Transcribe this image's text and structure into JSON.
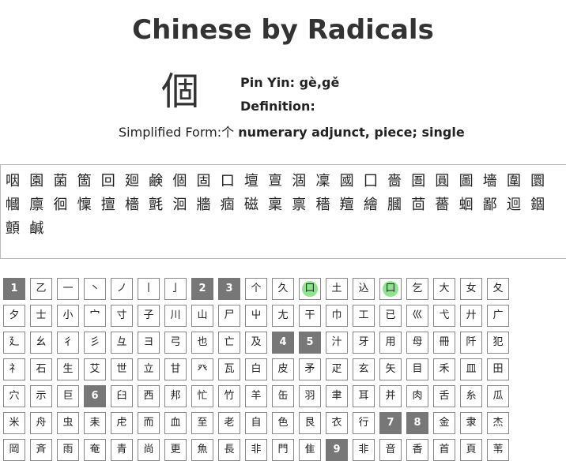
{
  "page": {
    "title": "Chinese by Radicals"
  },
  "character": {
    "glyph": "個",
    "pinyin_label": "Pin Yin: gè,gě",
    "definition_label": "Definition:",
    "simplified_label": "Simplified Form:个",
    "definition": "numerary adjunct, piece; single"
  },
  "related_chars": [
    "咽",
    "園",
    "菌",
    "箇",
    "回",
    "廻",
    "鹸",
    "個",
    "固",
    "口",
    "壇",
    "亶",
    "涸",
    "凜",
    "國",
    "囗",
    "嗇",
    "圄",
    "圓",
    "圖",
    "墻",
    "圍",
    "圜",
    "幗",
    "廪",
    "徊",
    "懍",
    "擅",
    "檣",
    "氈",
    "洄",
    "牆",
    "痼",
    "磁",
    "稟",
    "禀",
    "穡",
    "羶",
    "繪",
    "膕",
    "茴",
    "薔",
    "蛔",
    "鄙",
    "迴",
    "錮",
    "顫",
    "鹹"
  ],
  "radical_rows": [
    [
      {
        "t": "1",
        "k": "stroke"
      },
      {
        "t": "乙"
      },
      {
        "t": "一"
      },
      {
        "t": "丶"
      },
      {
        "t": "ノ"
      },
      {
        "t": "丨"
      },
      {
        "t": "亅"
      },
      {
        "t": "2",
        "k": "stroke"
      },
      {
        "t": "3",
        "k": "stroke"
      },
      {
        "t": "个"
      },
      {
        "t": "久"
      },
      {
        "t": "口",
        "k": "active"
      },
      {
        "t": "土"
      },
      {
        "t": "込"
      },
      {
        "t": "口",
        "k": "active"
      },
      {
        "t": "乞"
      },
      {
        "t": "大"
      },
      {
        "t": "女"
      },
      {
        "t": "夂"
      }
    ],
    [
      {
        "t": "夕"
      },
      {
        "t": "士"
      },
      {
        "t": "小"
      },
      {
        "t": "宀"
      },
      {
        "t": "寸"
      },
      {
        "t": "子"
      },
      {
        "t": "川"
      },
      {
        "t": "山"
      },
      {
        "t": "尸"
      },
      {
        "t": "屮"
      },
      {
        "t": "尢"
      },
      {
        "t": "干"
      },
      {
        "t": "巾"
      },
      {
        "t": "工"
      },
      {
        "t": "已"
      },
      {
        "t": "巛"
      },
      {
        "t": "弋"
      },
      {
        "t": "廾"
      },
      {
        "t": "广"
      }
    ],
    [
      {
        "t": "廴"
      },
      {
        "t": "幺"
      },
      {
        "t": "彳"
      },
      {
        "t": "彡"
      },
      {
        "t": "彑"
      },
      {
        "t": "ヨ"
      },
      {
        "t": "弓"
      },
      {
        "t": "也"
      },
      {
        "t": "亡"
      },
      {
        "t": "及"
      },
      {
        "t": "4",
        "k": "stroke"
      },
      {
        "t": "5",
        "k": "stroke"
      },
      {
        "t": "汁"
      },
      {
        "t": "牙"
      },
      {
        "t": "用"
      },
      {
        "t": "母"
      },
      {
        "t": "冊"
      },
      {
        "t": "阡"
      },
      {
        "t": "犯"
      }
    ],
    [
      {
        "t": "礻"
      },
      {
        "t": "石"
      },
      {
        "t": "生"
      },
      {
        "t": "艾"
      },
      {
        "t": "世"
      },
      {
        "t": "立"
      },
      {
        "t": "甘"
      },
      {
        "t": "癶"
      },
      {
        "t": "瓦"
      },
      {
        "t": "白"
      },
      {
        "t": "皮"
      },
      {
        "t": "矛"
      },
      {
        "t": "疋"
      },
      {
        "t": "玄"
      },
      {
        "t": "矢"
      },
      {
        "t": "目"
      },
      {
        "t": "禾"
      },
      {
        "t": "皿"
      },
      {
        "t": "田"
      }
    ],
    [
      {
        "t": "穴"
      },
      {
        "t": "示"
      },
      {
        "t": "巨"
      },
      {
        "t": "6",
        "k": "stroke"
      },
      {
        "t": "臼"
      },
      {
        "t": "西"
      },
      {
        "t": "邦"
      },
      {
        "t": "忙"
      },
      {
        "t": "竹"
      },
      {
        "t": "羊"
      },
      {
        "t": "缶"
      },
      {
        "t": "羽"
      },
      {
        "t": "聿"
      },
      {
        "t": "耳"
      },
      {
        "t": "并"
      },
      {
        "t": "肉"
      },
      {
        "t": "舌"
      },
      {
        "t": "糸"
      },
      {
        "t": "瓜"
      }
    ],
    [
      {
        "t": "米"
      },
      {
        "t": "舟"
      },
      {
        "t": "虫"
      },
      {
        "t": "耒"
      },
      {
        "t": "虍"
      },
      {
        "t": "而"
      },
      {
        "t": "血"
      },
      {
        "t": "至"
      },
      {
        "t": "老"
      },
      {
        "t": "自"
      },
      {
        "t": "色"
      },
      {
        "t": "艮"
      },
      {
        "t": "衣"
      },
      {
        "t": "行"
      },
      {
        "t": "7",
        "k": "stroke"
      },
      {
        "t": "8",
        "k": "stroke"
      },
      {
        "t": "金"
      },
      {
        "t": "隶"
      },
      {
        "t": "杰"
      }
    ],
    [
      {
        "t": "岡"
      },
      {
        "t": "斉"
      },
      {
        "t": "雨"
      },
      {
        "t": "奄"
      },
      {
        "t": "青"
      },
      {
        "t": "尚"
      },
      {
        "t": "更"
      },
      {
        "t": "魚"
      },
      {
        "t": "長"
      },
      {
        "t": "非"
      },
      {
        "t": "門"
      },
      {
        "t": "隹"
      },
      {
        "t": "9",
        "k": "stroke"
      },
      {
        "t": "非"
      },
      {
        "t": "音"
      },
      {
        "t": "香"
      },
      {
        "t": "首"
      },
      {
        "t": "頁"
      },
      {
        "t": "苇"
      }
    ]
  ],
  "colors": {
    "stroke_button": "#777777",
    "active_highlight": "#8fe38f"
  }
}
